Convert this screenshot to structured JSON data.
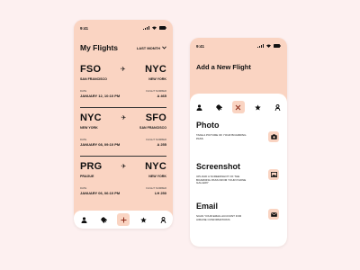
{
  "phone1": {
    "status_time": "9:41",
    "title": "My Flights",
    "filter_label": "LAST MONTH",
    "flights": [
      {
        "from_code": "FSO",
        "to_code": "NYC",
        "from_city": "SAN FRANCISCO",
        "to_city": "NEW YORK",
        "date_label": "DATE",
        "flight_label": "FLIGHT NUMBER",
        "date": "JANUARY 12, 10:10 PM",
        "flight_number": "A 465"
      },
      {
        "from_code": "NYC",
        "to_code": "SFO",
        "from_city": "NEW YORK",
        "to_city": "SAN FRANCISCO",
        "date_label": "DATE",
        "flight_label": "FLIGHT NUMBER",
        "date": "JANUARY 08, 09:10 PM",
        "flight_number": "A 255"
      },
      {
        "from_code": "PRG",
        "to_code": "NYC",
        "from_city": "PRAGUE",
        "to_city": "NEW YORK",
        "date_label": "DATE",
        "flight_label": "FLIGHT NUMBER",
        "date": "JANUARY 06, 06:10 PM",
        "flight_number": "LH 250"
      }
    ],
    "tabs": [
      {
        "icon": "user-icon"
      },
      {
        "icon": "flight-icon"
      },
      {
        "icon": "plus-icon",
        "active": true
      },
      {
        "icon": "star-icon"
      },
      {
        "icon": "profile-icon"
      }
    ]
  },
  "phone2": {
    "status_time": "9:41",
    "title": "Add a New Flight",
    "tabs": [
      {
        "icon": "user-icon"
      },
      {
        "icon": "flight-icon"
      },
      {
        "icon": "close-icon",
        "active": true
      },
      {
        "icon": "star-icon"
      },
      {
        "icon": "profile-icon"
      }
    ],
    "options": [
      {
        "title": "Photo",
        "description": "TAKE A PICTURE OF YOUR BOARDING PASS",
        "icon": "camera-icon"
      },
      {
        "title": "Screenshot",
        "description": "UPLOAD A SCREENSHOT OF THE BOARDING PASS FROM YOUR PHONE GALLERY",
        "icon": "image-icon"
      },
      {
        "title": "Email",
        "description": "SCAN YOUR EMAIL ACCOUNT FOR AIRLINE CONFIRMATIONS",
        "icon": "mail-icon"
      }
    ]
  },
  "colors": {
    "background": "#fdf0f0",
    "accent": "#fad4c2",
    "panel": "#ffffff",
    "text": "#111111"
  }
}
